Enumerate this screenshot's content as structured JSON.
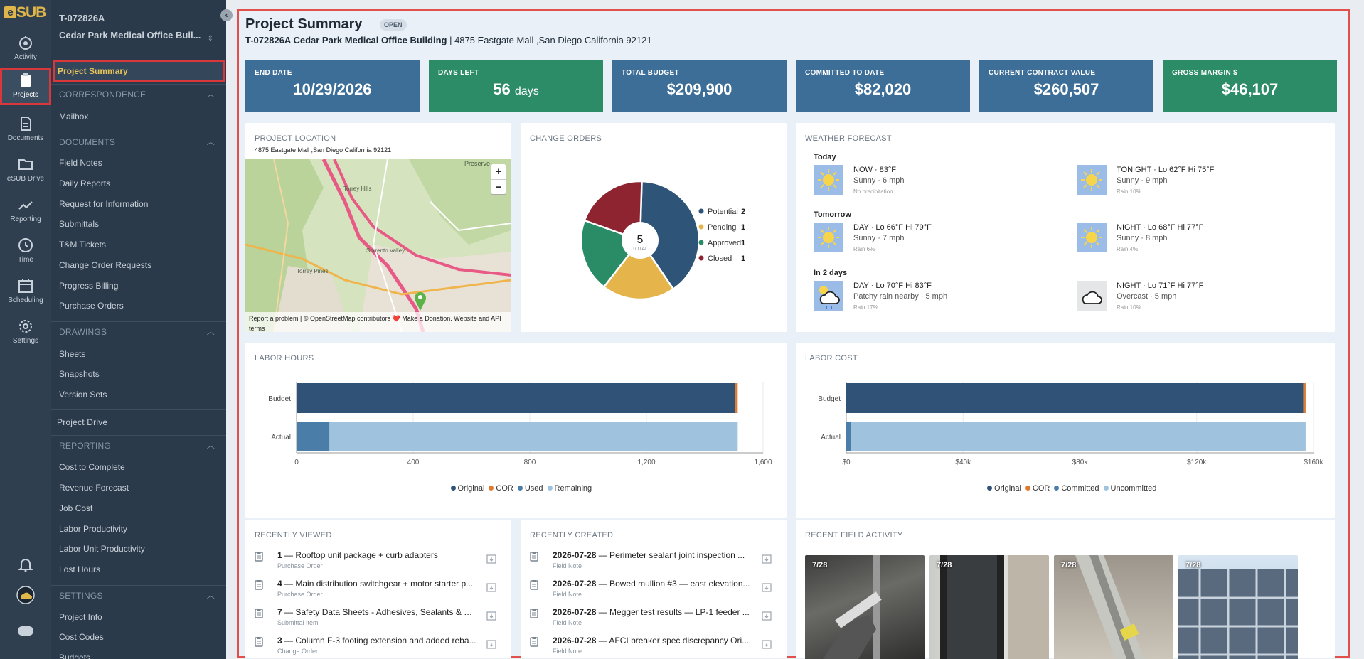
{
  "app": {
    "logo": "SUB",
    "logo_e": "e"
  },
  "rail": [
    {
      "label": "Activity",
      "icon": "activity-icon"
    },
    {
      "label": "Projects",
      "icon": "projects-icon"
    },
    {
      "label": "Documents",
      "icon": "documents-icon"
    },
    {
      "label": "eSUB Drive",
      "icon": "folder-icon"
    },
    {
      "label": "Reporting",
      "icon": "reporting-icon"
    },
    {
      "label": "Time",
      "icon": "clock-icon"
    },
    {
      "label": "Scheduling",
      "icon": "calendar-icon"
    },
    {
      "label": "Settings",
      "icon": "gear-icon"
    }
  ],
  "project": {
    "number": "T-072826A",
    "name": "Cedar Park Medical Office Buil...",
    "switch_icon": "⇕"
  },
  "sidebar": {
    "selected": "Project Summary",
    "sections": [
      {
        "title": "CORRESPONDENCE",
        "items": [
          "Mailbox"
        ]
      },
      {
        "title": "DOCUMENTS",
        "items": [
          "Field Notes",
          "Daily Reports",
          "Request for Information",
          "Submittals",
          "T&M Tickets",
          "Change Order Requests",
          "Progress Billing",
          "Purchase Orders"
        ]
      },
      {
        "title": "DRAWINGS",
        "items": [
          "Sheets",
          "Snapshots",
          "Version Sets"
        ]
      },
      {
        "title": "REPORTING",
        "items": [
          "Cost to Complete",
          "Revenue Forecast",
          "Job Cost",
          "Labor Productivity",
          "Labor Unit Productivity",
          "Lost Hours"
        ]
      },
      {
        "title": "SETTINGS",
        "items": [
          "Project Info",
          "Cost Codes",
          "Budgets"
        ]
      }
    ],
    "project_drive": "Project Drive"
  },
  "header": {
    "title": "Project Summary",
    "status": "OPEN",
    "project_line_bold": "T-072826A Cedar Park Medical Office Building",
    "project_line_sep": " | ",
    "project_line_address": "4875 Eastgate Mall ,San Diego California 92121"
  },
  "kpis": [
    {
      "label": "END DATE",
      "value": "10/29/2026",
      "unit": "",
      "color": "#3c6e98"
    },
    {
      "label": "DAYS LEFT",
      "value": "56",
      "unit": "days",
      "color": "#2c8c68"
    },
    {
      "label": "TOTAL BUDGET",
      "value": "$209,900",
      "unit": "",
      "color": "#3c6e98"
    },
    {
      "label": "COMMITTED TO DATE",
      "value": "$82,020",
      "unit": "",
      "color": "#3c6e98"
    },
    {
      "label": "CURRENT CONTRACT VALUE",
      "value": "$260,507",
      "unit": "",
      "color": "#3c6e98"
    },
    {
      "label": "GROSS MARGIN $",
      "value": "$46,107",
      "unit": "",
      "color": "#2c8c68"
    }
  ],
  "location": {
    "title": "PROJECT LOCATION",
    "address": "4875 Eastgate Mall ,San Diego California 92121",
    "zoom_in": "+",
    "zoom_out": "−",
    "attribution": "Report a problem | © OpenStreetMap contributors ❤️ Make a Donation. Website and API terms",
    "place_labels": [
      "Preserve",
      "Torrey Hills",
      "Torrey Pines",
      "Sorrento Valley"
    ]
  },
  "change_orders": {
    "title": "CHANGE ORDERS",
    "total": "5",
    "total_label": "TOTAL",
    "colors": {
      "Potential": "#2e5478",
      "Pending": "#e5b54c",
      "Approved": "#2a8c66",
      "Closed": "#8e2430"
    }
  },
  "weather": {
    "title": "WEATHER FORECAST",
    "groups": [
      {
        "label": "Today",
        "items": [
          {
            "head": "NOW · ",
            "temps": "83°F",
            "desc": "Sunny · 6 mph",
            "note": "No precipitation",
            "icon": "sun-icon"
          },
          {
            "head": "TONIGHT · Lo ",
            "temps": "62°F Hi 75°F",
            "desc": "Sunny · 9 mph",
            "note": "Rain 10%",
            "icon": "sun-icon"
          }
        ]
      },
      {
        "label": "Tomorrow",
        "items": [
          {
            "head": "DAY · Lo ",
            "temps": "66°F Hi 79°F",
            "desc": "Sunny · 7 mph",
            "note": "Rain 6%",
            "icon": "sun-icon"
          },
          {
            "head": "NIGHT · Lo ",
            "temps": "68°F Hi 77°F",
            "desc": "Sunny · 8 mph",
            "note": "Rain 4%",
            "icon": "sun-icon"
          }
        ]
      },
      {
        "label": "In 2 days",
        "items": [
          {
            "head": "DAY · Lo ",
            "temps": "70°F Hi 83°F",
            "desc": "Patchy rain nearby · 5 mph",
            "note": "Rain 17%",
            "icon": "rain-cloud-icon"
          },
          {
            "head": "NIGHT · Lo ",
            "temps": "71°F Hi 77°F",
            "desc": "Overcast · 5 mph",
            "note": "Rain 10%",
            "icon": "cloud-icon"
          }
        ]
      }
    ]
  },
  "labor_hours": {
    "title": "LABOR HOURS"
  },
  "labor_cost": {
    "title": "LABOR COST"
  },
  "chart_data": [
    {
      "type": "pie",
      "title": "CHANGE ORDERS",
      "categories": [
        "Potential",
        "Pending",
        "Approved",
        "Closed"
      ],
      "values": [
        2,
        1,
        1,
        1
      ]
    },
    {
      "type": "bar",
      "title": "LABOR HOURS",
      "orientation": "horizontal",
      "stacked": true,
      "categories": [
        "Budget",
        "Actual"
      ],
      "series": [
        {
          "name": "Original",
          "values": [
            1505,
            0
          ],
          "color": "#2f5276"
        },
        {
          "name": "COR",
          "values": [
            8,
            0
          ],
          "color": "#e07a2e"
        },
        {
          "name": "Used",
          "values": [
            0,
            113
          ],
          "color": "#4a7ea8"
        },
        {
          "name": "Remaining",
          "values": [
            0,
            1400
          ],
          "color": "#9fc3de"
        }
      ],
      "xlim": [
        0,
        1600
      ],
      "xticks": [
        "0",
        "400",
        "800",
        "1,200",
        "1,600"
      ],
      "legend": "bottom",
      "grid": true
    },
    {
      "type": "bar",
      "title": "LABOR COST",
      "orientation": "horizontal",
      "stacked": true,
      "categories": [
        "Budget",
        "Actual"
      ],
      "series": [
        {
          "name": "Original",
          "values": [
            156500,
            0
          ],
          "color": "#2f5276"
        },
        {
          "name": "COR",
          "values": [
            800,
            0
          ],
          "color": "#e07a2e"
        },
        {
          "name": "Committed",
          "values": [
            0,
            1500
          ],
          "color": "#4a7ea8"
        },
        {
          "name": "Uncommitted",
          "values": [
            0,
            155800
          ],
          "color": "#9fc3de"
        }
      ],
      "xlim": [
        0,
        160000
      ],
      "xticks": [
        "$0",
        "$40k",
        "$80k",
        "$120k",
        "$160k"
      ],
      "legend": "bottom",
      "grid": true
    }
  ],
  "recently_viewed": {
    "title": "RECENTLY VIEWED",
    "items": [
      {
        "num": "1",
        "text": " — Rooftop unit package + curb adapters",
        "type": "Purchase Order"
      },
      {
        "num": "4",
        "text": " — Main distribution switchgear + motor starter p...",
        "type": "Purchase Order"
      },
      {
        "num": "7",
        "text": " — Safety Data Sheets - Adhesives, Sealants & Ca...",
        "type": "Submittal Item"
      },
      {
        "num": "3",
        "text": " — Column F-3 footing extension and added reba...",
        "type": "Change Order"
      }
    ]
  },
  "recently_created": {
    "title": "RECENTLY CREATED",
    "items": [
      {
        "num": "2026-07-28",
        "text": " — Perimeter sealant joint inspection ...",
        "type": "Field Note"
      },
      {
        "num": "2026-07-28",
        "text": " — Bowed mullion #3 — east elevation...",
        "type": "Field Note"
      },
      {
        "num": "2026-07-28",
        "text": " — Megger test results — LP-1 feeder ...",
        "type": "Field Note"
      },
      {
        "num": "2026-07-28",
        "text": " — AFCI breaker spec discrepancy Ori...",
        "type": "Field Note"
      }
    ]
  },
  "field_activity": {
    "title": "RECENT FIELD ACTIVITY",
    "photos": [
      {
        "date": "7/28"
      },
      {
        "date": "7/28"
      },
      {
        "date": "7/28"
      },
      {
        "date": "7/28"
      }
    ]
  }
}
